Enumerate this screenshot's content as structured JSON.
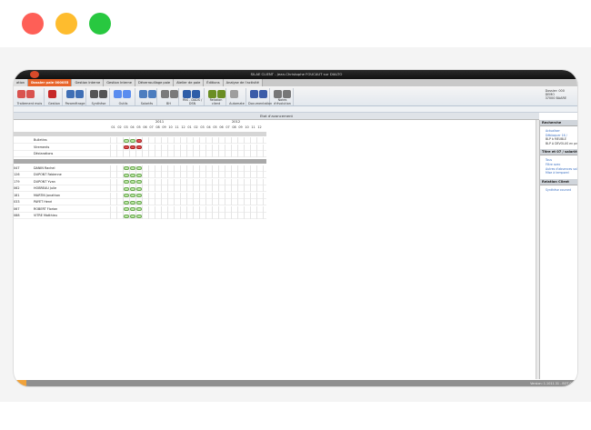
{
  "window": {
    "title": "SILAE CLIENT - Jean-Christophe FOUCAUT sur DIALTO"
  },
  "tabs": [
    {
      "label": "ation"
    },
    {
      "label": "Dossier paie 000055",
      "active": true
    },
    {
      "label": "Gestion Interne"
    },
    {
      "label": "Gestion Interne"
    },
    {
      "label": "Déverrouillage paie"
    },
    {
      "label": "Atelier de paie"
    },
    {
      "label": "Éditions"
    },
    {
      "label": "Analyse de l'activité"
    }
  ],
  "toolbar": {
    "groups": [
      {
        "label": "Traitement mois",
        "color": "#d9534f"
      },
      {
        "label": "Gestion",
        "color": "#c62828"
      },
      {
        "label": "Paramétrage",
        "color": "#3f6fb5"
      },
      {
        "label": "Synthèse",
        "color": "#555555"
      },
      {
        "label": "Outils",
        "color": "#5b8def"
      },
      {
        "label": "Salariés",
        "color": "#4c7dbf"
      },
      {
        "label": "BH",
        "color": "#7a7a7a"
      },
      {
        "label": "PAS - DADS / DSN",
        "color": "#2f5ea8"
      },
      {
        "label": "Relation client",
        "color": "#6b8e23"
      },
      {
        "label": "Automate",
        "color": "#9e9e9e"
      },
      {
        "label": "Documentation",
        "color": "#3b5ca8"
      },
      {
        "label": "Notes d'évolution",
        "color": "#777777"
      }
    ],
    "user_info": [
      "Dossier: 000",
      "DEMO",
      "37000 BAARE"
    ]
  },
  "content": {
    "section_title": "Etat d'avancement",
    "years": [
      "2011",
      "2012"
    ],
    "months": [
      "01",
      "02",
      "03",
      "04",
      "05",
      "06",
      "07",
      "08",
      "09",
      "10",
      "11",
      "12",
      "01",
      "02",
      "03",
      "04",
      "05",
      "06",
      "07",
      "08",
      "09",
      "10",
      "11",
      "12"
    ],
    "summary_rows": [
      {
        "name": "Bulletins"
      },
      {
        "name": "Virements"
      },
      {
        "name": "Déclarations"
      }
    ],
    "employees": [
      {
        "code": "047",
        "name": "DANIN Rachel"
      },
      {
        "code": "126",
        "name": "DUPONT Fabienne"
      },
      {
        "code": "179",
        "name": "DUPONT Yvan"
      },
      {
        "code": "062",
        "name": "HOBREAU Julie"
      },
      {
        "code": "181",
        "name": "MARTIN Jonathan"
      },
      {
        "code": "033",
        "name": "PAYET Henri"
      },
      {
        "code": "067",
        "name": "ROBERT Florian"
      },
      {
        "code": "088",
        "name": "VITRE Matthieu"
      }
    ]
  },
  "right_panel": {
    "sections": [
      {
        "title": "Recherche",
        "items": [
          {
            "label": "Actualiser"
          },
          {
            "label": "Débloquer 16 /"
          },
          {
            "label": "BLP à MEUBLE"
          },
          {
            "label": "BLP A DEVOLUS en préparation"
          }
        ]
      },
      {
        "title": "Titre et 07 / salariés",
        "items": [
          {
            "label": "Tous"
          },
          {
            "label": "Filtre avec"
          },
          {
            "label": "Autres d'absences salariés"
          },
          {
            "label": "Mise à temporel"
          }
        ]
      },
      {
        "title": "Relation Client",
        "items": [
          {
            "label": "Synthèse courant"
          }
        ]
      }
    ]
  },
  "status_bar": {
    "version": "Version: 1.1011.31 - BOT 000"
  }
}
